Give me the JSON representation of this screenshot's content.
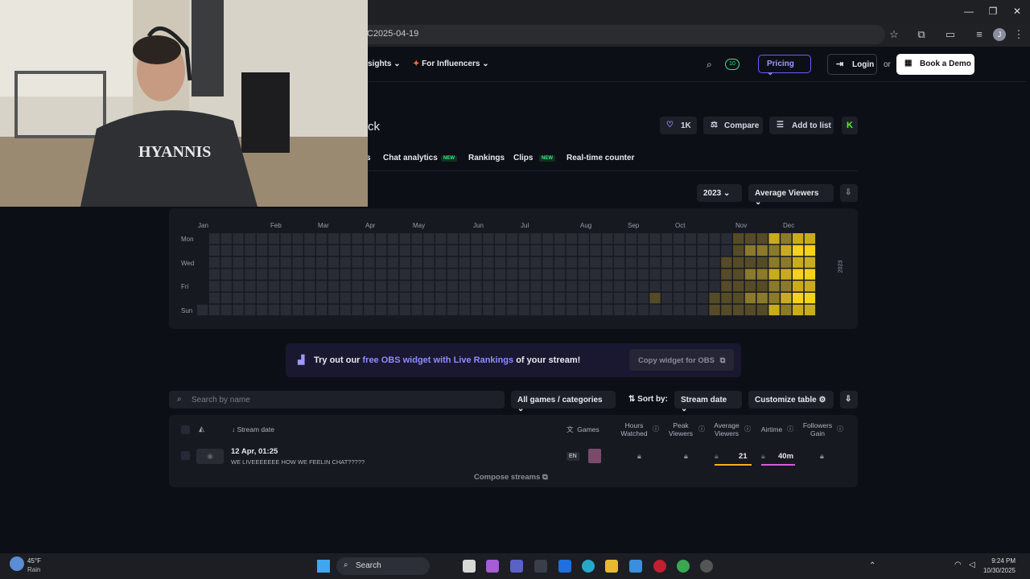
{
  "browser": {
    "address": "C2025-04-19"
  },
  "header": {
    "nav1": "sights",
    "nav2": "For Influencers",
    "pricing": "Pricing",
    "login": "Login",
    "or": "or",
    "demo": "Book a Demo",
    "badge": "10"
  },
  "profile": {
    "name_fragment": "ck",
    "likes": "1K",
    "compare": "Compare",
    "add_to_list": "Add to list",
    "k_label": "K"
  },
  "tabs": [
    {
      "label": "s"
    },
    {
      "label": "Chat analytics",
      "new": "NEW"
    },
    {
      "label": "Rankings"
    },
    {
      "label": "Clips",
      "new": "NEW"
    },
    {
      "label": "Real-time counter"
    }
  ],
  "controls": {
    "year": "2023",
    "metric": "Average Viewers"
  },
  "heatmap": {
    "months": [
      "Jan",
      "Feb",
      "Mar",
      "Apr",
      "May",
      "Jun",
      "Jul",
      "Aug",
      "Sep",
      "Oct",
      "Nov",
      "Dec"
    ],
    "days": [
      "Mon",
      "Wed",
      "Fri",
      "Sun"
    ],
    "year_label": "2023",
    "colors": {
      "empty": "#2a2c35",
      "low": "#554b27",
      "mid": "#8a7a2a",
      "high": "#c8ac1e",
      "max": "#f6d31a"
    }
  },
  "obs": {
    "pre": "Try out our ",
    "link": "free OBS widget with Live Rankings",
    "post": " of your stream!",
    "copy": "Copy widget for OBS"
  },
  "filters": {
    "search_placeholder": "Search by name",
    "games": "All games / categories",
    "sort_label": "Sort by:",
    "sort_value": "Stream date",
    "customize": "Customize table"
  },
  "table": {
    "headers": {
      "stream_date": "Stream date",
      "games": "Games",
      "hours": "Hours Watched",
      "peak": "Peak Viewers",
      "avg": "Average Viewers",
      "airtime": "Airtime",
      "followers": "Followers Gain"
    },
    "rows": [
      {
        "date": "12 Apr, 01:25",
        "title": "WE LIVEEEEEEE HOW WE FEELIN CHAT?????",
        "lang": "EN",
        "avg": "21",
        "airtime": "40m"
      }
    ],
    "compose": "Compose streams"
  },
  "taskbar": {
    "temp": "45°F",
    "weather": "Rain",
    "search": "Search",
    "time": "9:24 PM",
    "date": "10/30/2025"
  }
}
